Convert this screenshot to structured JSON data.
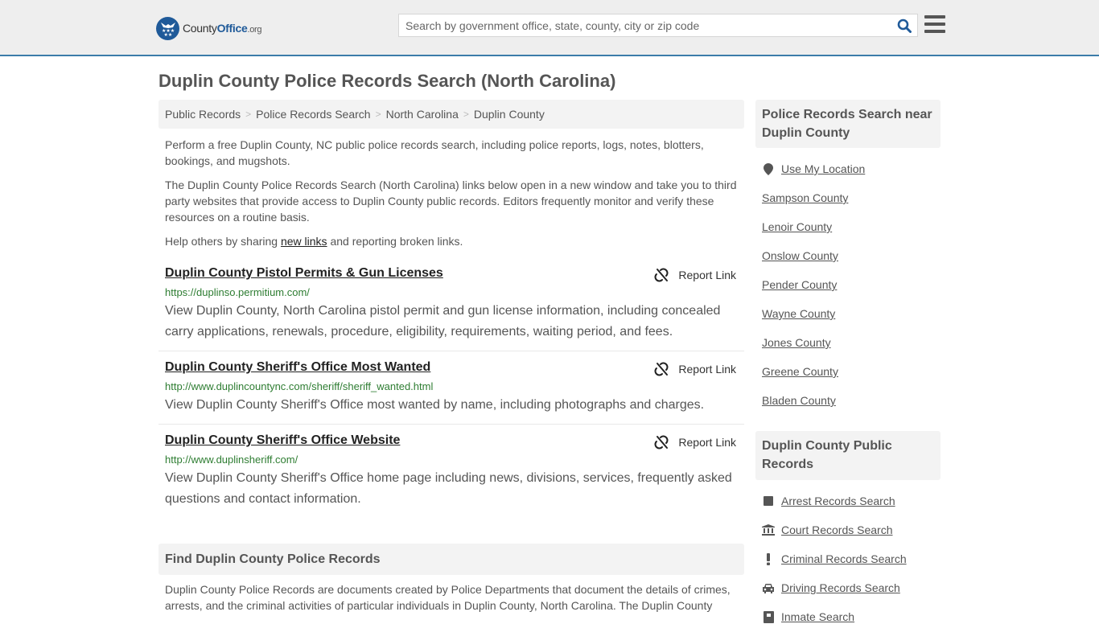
{
  "header": {
    "logo_text_county": "County",
    "logo_text_office": "Office",
    "logo_text_org": ".org",
    "search_placeholder": "Search by government office, state, county, city or zip code",
    "search_value": ""
  },
  "page_title": "Duplin County Police Records Search (North Carolina)",
  "breadcrumb": [
    "Public Records",
    "Police Records Search",
    "North Carolina",
    "Duplin County"
  ],
  "intro": {
    "p1": "Perform a free Duplin County, NC public police records search, including police reports, logs, notes, blotters, bookings, and mugshots.",
    "p2": "The Duplin County Police Records Search (North Carolina) links below open in a new window and take you to third party websites that provide access to Duplin County public records. Editors frequently monitor and verify these resources on a routine basis.",
    "p3_before": "Help others by sharing ",
    "p3_link": "new links",
    "p3_after": " and reporting broken links."
  },
  "results": [
    {
      "title": "Duplin County Pistol Permits & Gun Licenses",
      "url": "https://duplinso.permitium.com/",
      "description": "View Duplin County, North Carolina pistol permit and gun license information, including concealed carry applications, renewals, procedure, eligibility, requirements, waiting period, and fees.",
      "report_label": "Report Link"
    },
    {
      "title": "Duplin County Sheriff's Office Most Wanted",
      "url": "http://www.duplincountync.com/sheriff/sheriff_wanted.html",
      "description": "View Duplin County Sheriff's Office most wanted by name, including photographs and charges.",
      "report_label": "Report Link"
    },
    {
      "title": "Duplin County Sheriff's Office Website",
      "url": "http://www.duplinsheriff.com/",
      "description": "View Duplin County Sheriff's Office home page including news, divisions, services, frequently asked questions and contact information.",
      "report_label": "Report Link"
    }
  ],
  "find_section": {
    "heading": "Find Duplin County Police Records",
    "body": "Duplin County Police Records are documents created by Police Departments that document the details of crimes, arrests, and the criminal activities of particular individuals in Duplin County, North Carolina. The Duplin County"
  },
  "sidebar": {
    "nearby_heading": "Police Records Search near Duplin County",
    "use_location": "Use My Location",
    "nearby": [
      "Sampson County",
      "Lenoir County",
      "Onslow County",
      "Pender County",
      "Wayne County",
      "Jones County",
      "Greene County",
      "Bladen County"
    ],
    "public_records_heading": "Duplin County Public Records",
    "public_records": [
      {
        "label": "Arrest Records Search",
        "icon": "square-icon"
      },
      {
        "label": "Court Records Search",
        "icon": "courthouse-icon"
      },
      {
        "label": "Criminal Records Search",
        "icon": "exclamation-icon"
      },
      {
        "label": "Driving Records Search",
        "icon": "car-icon"
      },
      {
        "label": "Inmate Search",
        "icon": "inmate-icon"
      }
    ]
  },
  "colors": {
    "accent": "#3b7ca9",
    "logo_blue": "#1f5a99",
    "url_green": "#2e7d32"
  }
}
